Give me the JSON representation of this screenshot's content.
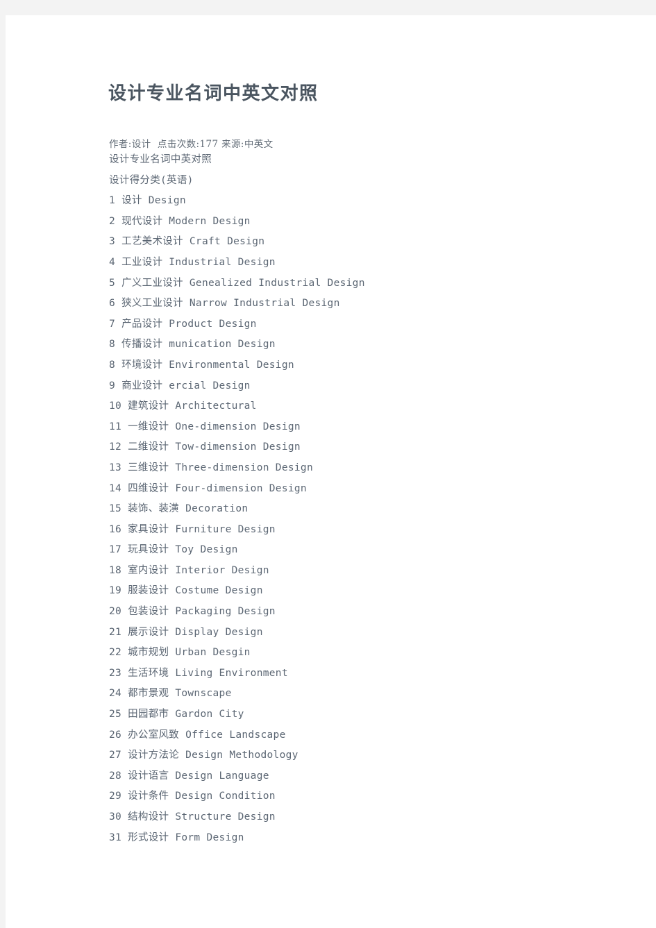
{
  "document": {
    "title": "设计专业名词中英文对照",
    "byline": "作者:设计  点击次数:177 来源:中英文",
    "intro_lines": [
      "设计专业名词中英对照",
      "设计得分类(英语)"
    ],
    "colors": {
      "page_background": "#ffffff",
      "outer_background": "#f3f3f3",
      "title_text": "#4a5560",
      "body_text": "#5b6673"
    },
    "terms": [
      {
        "num": "1",
        "cn": "设计",
        "en": "Design"
      },
      {
        "num": "2",
        "cn": "现代设计",
        "en": "Modern Design"
      },
      {
        "num": "3",
        "cn": "工艺美术设计",
        "en": "Craft Design"
      },
      {
        "num": "4",
        "cn": "工业设计",
        "en": "Industrial Design"
      },
      {
        "num": "5",
        "cn": "广义工业设计",
        "en": "Genealized Industrial Design"
      },
      {
        "num": "6",
        "cn": "狭义工业设计",
        "en": "Narrow Industrial Design"
      },
      {
        "num": "7",
        "cn": "产品设计",
        "en": "Product Design"
      },
      {
        "num": "8",
        "cn": "传播设计",
        "en": "munication Design"
      },
      {
        "num": "8",
        "cn": "环境设计",
        "en": "Environmental Design"
      },
      {
        "num": "9",
        "cn": "商业设计",
        "en": "ercial Design"
      },
      {
        "num": "10",
        "cn": "建筑设计",
        "en": "Architectural"
      },
      {
        "num": "11",
        "cn": "一维设计",
        "en": "One-dimension Design"
      },
      {
        "num": "12",
        "cn": "二维设计",
        "en": "Tow-dimension Design"
      },
      {
        "num": "13",
        "cn": "三维设计",
        "en": "Three-dimension Design"
      },
      {
        "num": "14",
        "cn": "四维设计",
        "en": "Four-dimension Design"
      },
      {
        "num": "15",
        "cn": "装饰、装潢",
        "en": "Decoration"
      },
      {
        "num": "16",
        "cn": "家具设计",
        "en": "Furniture Design"
      },
      {
        "num": "17",
        "cn": "玩具设计",
        "en": "Toy Design"
      },
      {
        "num": "18",
        "cn": "室内设计",
        "en": "Interior Design"
      },
      {
        "num": "19",
        "cn": "服装设计",
        "en": "Costume Design"
      },
      {
        "num": "20",
        "cn": "包装设计",
        "en": "Packaging Design"
      },
      {
        "num": "21",
        "cn": "展示设计",
        "en": "Display Design"
      },
      {
        "num": "22",
        "cn": "城市规划",
        "en": "Urban Desgin"
      },
      {
        "num": "23",
        "cn": "生活环境",
        "en": "Living Environment"
      },
      {
        "num": "24",
        "cn": "都市景观",
        "en": "Townscape"
      },
      {
        "num": "25",
        "cn": "田园都市",
        "en": "Gardon City"
      },
      {
        "num": "26",
        "cn": "办公室风致",
        "en": "Office Landscape"
      },
      {
        "num": "27",
        "cn": "设计方法论",
        "en": "Design Methodology"
      },
      {
        "num": "28",
        "cn": "设计语言",
        "en": "Design Language"
      },
      {
        "num": "29",
        "cn": "设计条件",
        "en": "Design Condition"
      },
      {
        "num": "30",
        "cn": "结构设计",
        "en": "Structure Design"
      },
      {
        "num": "31",
        "cn": "形式设计",
        "en": "Form Design"
      }
    ]
  }
}
